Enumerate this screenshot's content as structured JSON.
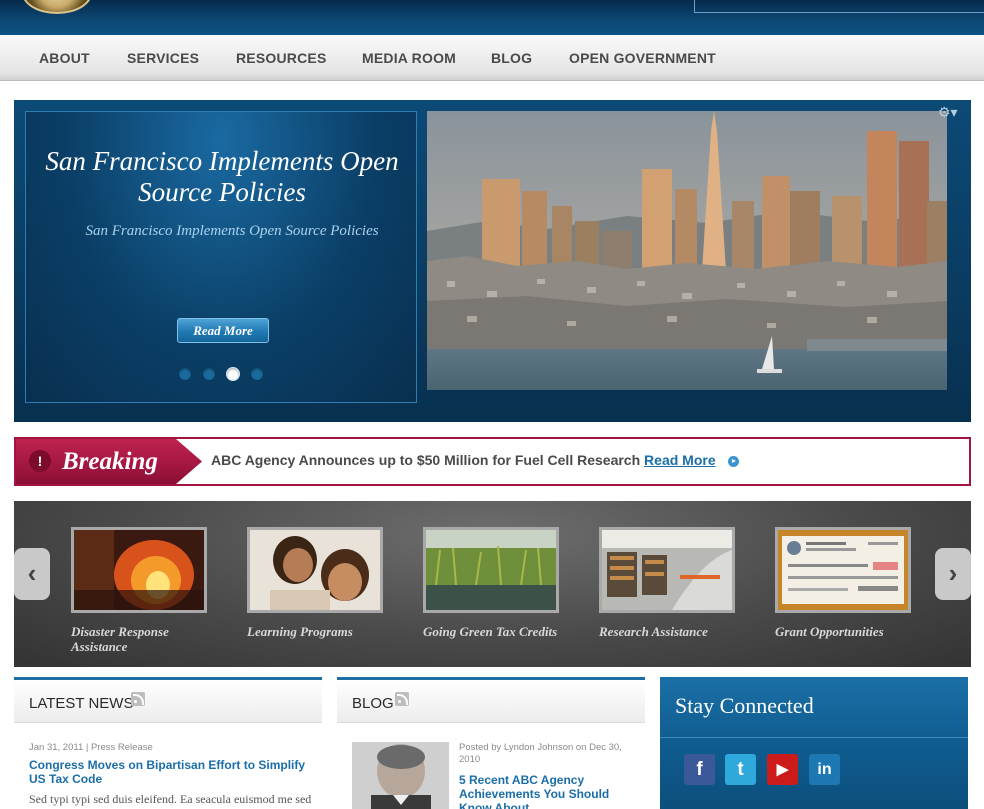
{
  "nav": {
    "items": [
      "ABOUT",
      "SERVICES",
      "RESOURCES",
      "MEDIA ROOM",
      "BLOG",
      "OPEN GOVERNMENT"
    ]
  },
  "hero": {
    "title": "San Francisco Implements Open Source Policies",
    "subtitle": "San Francisco Implements Open Source Policies",
    "button_label": "Read More",
    "slide_count": 4,
    "active_slide": 3
  },
  "breaking": {
    "label": "Breaking",
    "icon_glyph": "!",
    "headline": "ABC Agency Announces up to $50 Million for Fuel Cell Research",
    "link_label": "Read More"
  },
  "carousel": {
    "prev_glyph": "‹",
    "next_glyph": "›",
    "items": [
      {
        "label": "Disaster Response Assistance"
      },
      {
        "label": "Learning Programs"
      },
      {
        "label": "Going Green Tax Credits"
      },
      {
        "label": "Research Assistance"
      },
      {
        "label": "Grant Opportunities"
      }
    ]
  },
  "latest_news": {
    "title": "LATEST NEWS",
    "meta": "Jan 31, 2011 | Press Release",
    "headline": "Congress Moves on Bipartisan Effort to Simplify US Tax Code",
    "excerpt": "Sed typi typi sed duis eleifend. Ea seacula euismod me sed"
  },
  "blog": {
    "title": "BLOG",
    "meta": "Posted by Lyndon Johnson on Dec 30, 2010",
    "headline": "5 Recent ABC Agency Achievements You Should Know About"
  },
  "stay_connected": {
    "title": "Stay Connected",
    "icons": [
      {
        "name": "facebook-icon",
        "glyph": "f",
        "color": "#3b5998"
      },
      {
        "name": "twitter-icon",
        "glyph": "t",
        "color": "#2fa8dc"
      },
      {
        "name": "youtube-icon",
        "glyph": "▶",
        "color": "#cc1b1b"
      },
      {
        "name": "linkedin-icon",
        "glyph": "in",
        "color": "#1c77b3"
      }
    ]
  }
}
